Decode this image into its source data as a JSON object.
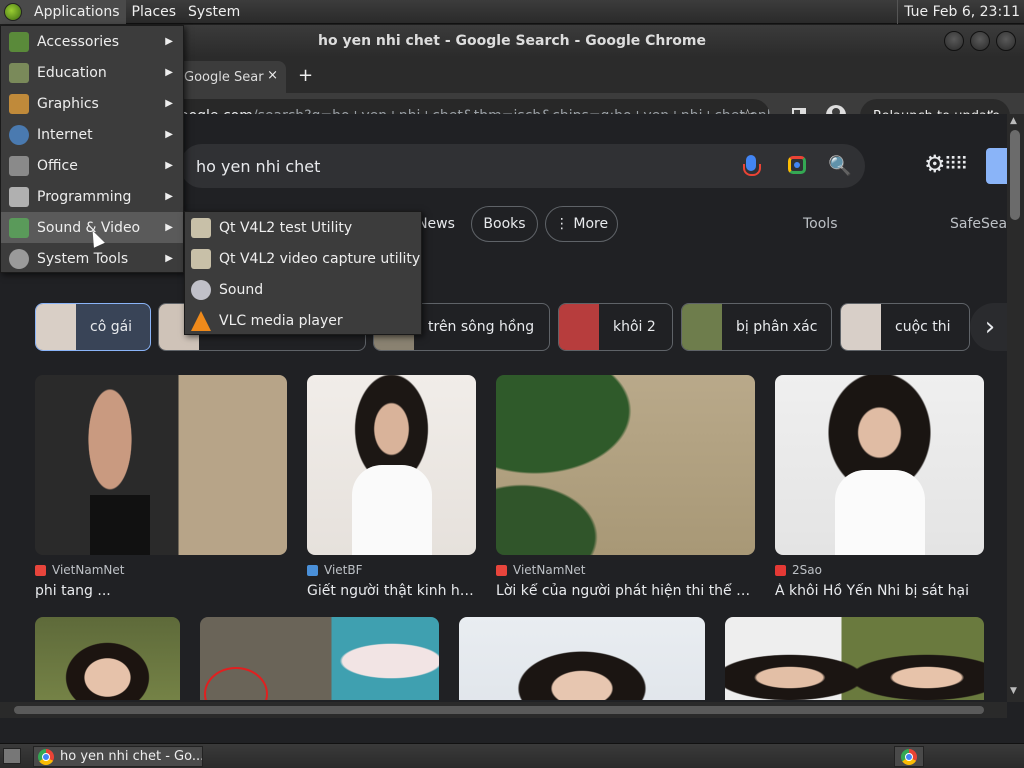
{
  "top_panel": {
    "menus": [
      "Applications",
      "Places",
      "System"
    ],
    "clock": "Tue Feb  6, 23:11"
  },
  "window": {
    "title": "ho yen nhi chet - Google Search - Google Chrome"
  },
  "tab": {
    "label": "Google Sear",
    "close": "×",
    "new_tab": "+"
  },
  "toolbar": {
    "url_host": "oogle.com",
    "url_path": "/search?q=ho+yen+nhi+chet&tbm=isch&chips=q:ho+yen+nhi+chet,online_c...",
    "star": "☆",
    "relaunch": "Relaunch to update",
    "menu": "⋮"
  },
  "search": {
    "query": "ho yen nhi chet",
    "search_glyph": "🔍"
  },
  "nav_chips": [
    "News",
    "Books",
    "⋮ More"
  ],
  "tools_label": "Tools",
  "safesearch_label": "SafeSear",
  "filter_chips": [
    {
      "label": "cô gái",
      "color": "#d9cfc6"
    },
    {
      "label": "",
      "color": "#cfc3b8"
    },
    {
      "label": "trên sông hồng",
      "color": "#8a8271"
    },
    {
      "label": "khôi 2",
      "color": "#b73d3d"
    },
    {
      "label": "bị phân xác",
      "color": "#6e7d4c"
    },
    {
      "label": "cuộc thi",
      "color": "#d8cfc8"
    }
  ],
  "chip_next": "›",
  "results": [
    {
      "source": "VietNamNet",
      "title": "phi tang ...",
      "fav_color": "#e8453c"
    },
    {
      "source": "VietBF",
      "title": "Giết người thật kinh ho...",
      "fav_color": "#4a90d9"
    },
    {
      "source": "VietNamNet",
      "title": "Lời kể của người phát hiện thi thể á ...",
      "fav_color": "#e8453c"
    },
    {
      "source": "2Sao",
      "title": "Á khôi Hồ Yến Nhi bị sát hại",
      "fav_color": "#e53935"
    }
  ],
  "apps_menu": {
    "items": [
      {
        "label": "Accessories",
        "icon_color": "#5a8a3a"
      },
      {
        "label": "Education",
        "icon_color": "#7a8a5a"
      },
      {
        "label": "Graphics",
        "icon_color": "#c08a3a"
      },
      {
        "label": "Internet",
        "icon_color": "#4a7ab0"
      },
      {
        "label": "Office",
        "icon_color": "#8a8a8a"
      },
      {
        "label": "Programming",
        "icon_color": "#b0b0b0"
      },
      {
        "label": "Sound & Video",
        "icon_color": "#5a9a5a"
      },
      {
        "label": "System Tools",
        "icon_color": "#9a9a9a"
      }
    ],
    "arrow": "▶"
  },
  "submenu": {
    "items": [
      {
        "label": "Qt V4L2 test Utility",
        "icon_color": "#c8c0a8"
      },
      {
        "label": "Qt V4L2 video capture utility",
        "icon_color": "#c8c0a8"
      },
      {
        "label": "Sound",
        "icon_color": "#c0c0c8"
      },
      {
        "label": "VLC media player",
        "icon_color": "#f08a1a"
      }
    ]
  },
  "taskbar": {
    "task_label": "ho yen nhi chet - Go..."
  }
}
